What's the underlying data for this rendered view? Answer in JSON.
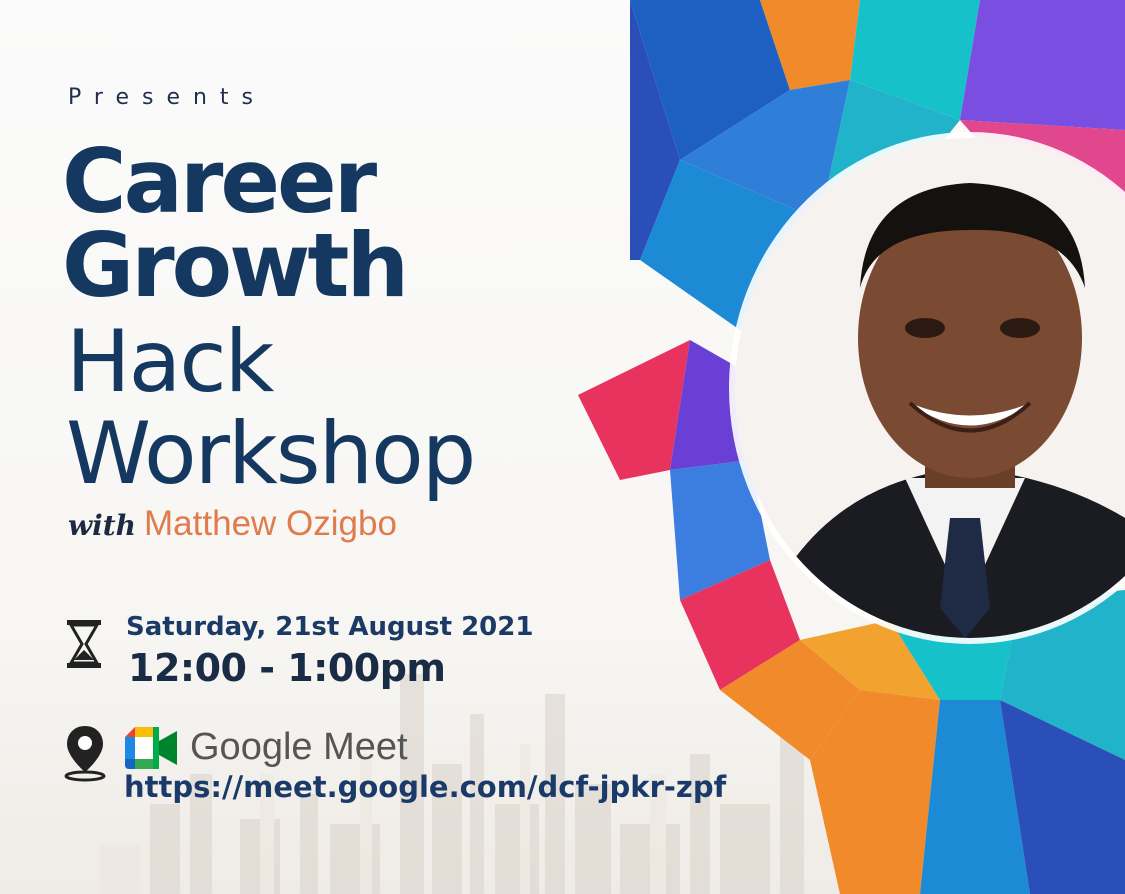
{
  "poster": {
    "presents": "Presents",
    "title_line1": "Career",
    "title_line2": "Growth",
    "title_line3": "Hack",
    "title_line4": "Workshop",
    "with_word": "with",
    "speaker_name": "Matthew Ozigbo",
    "date": "Saturday, 21st August 2021",
    "time": "12:00 - 1:00pm",
    "platform": "Google Meet",
    "link": "https://meet.google.com/dcf-jpkr-zpf"
  },
  "icons": {
    "time": "hourglass-icon",
    "location": "location-pin-icon",
    "platform": "google-meet-icon"
  },
  "colors": {
    "title": "#14385f",
    "speaker": "#e07b4e",
    "accent_blue": "#1e5fc2",
    "accent_purple": "#7a4ee0",
    "accent_orange": "#f08a2b",
    "accent_pink": "#e8335f",
    "accent_teal": "#16c1c9"
  }
}
